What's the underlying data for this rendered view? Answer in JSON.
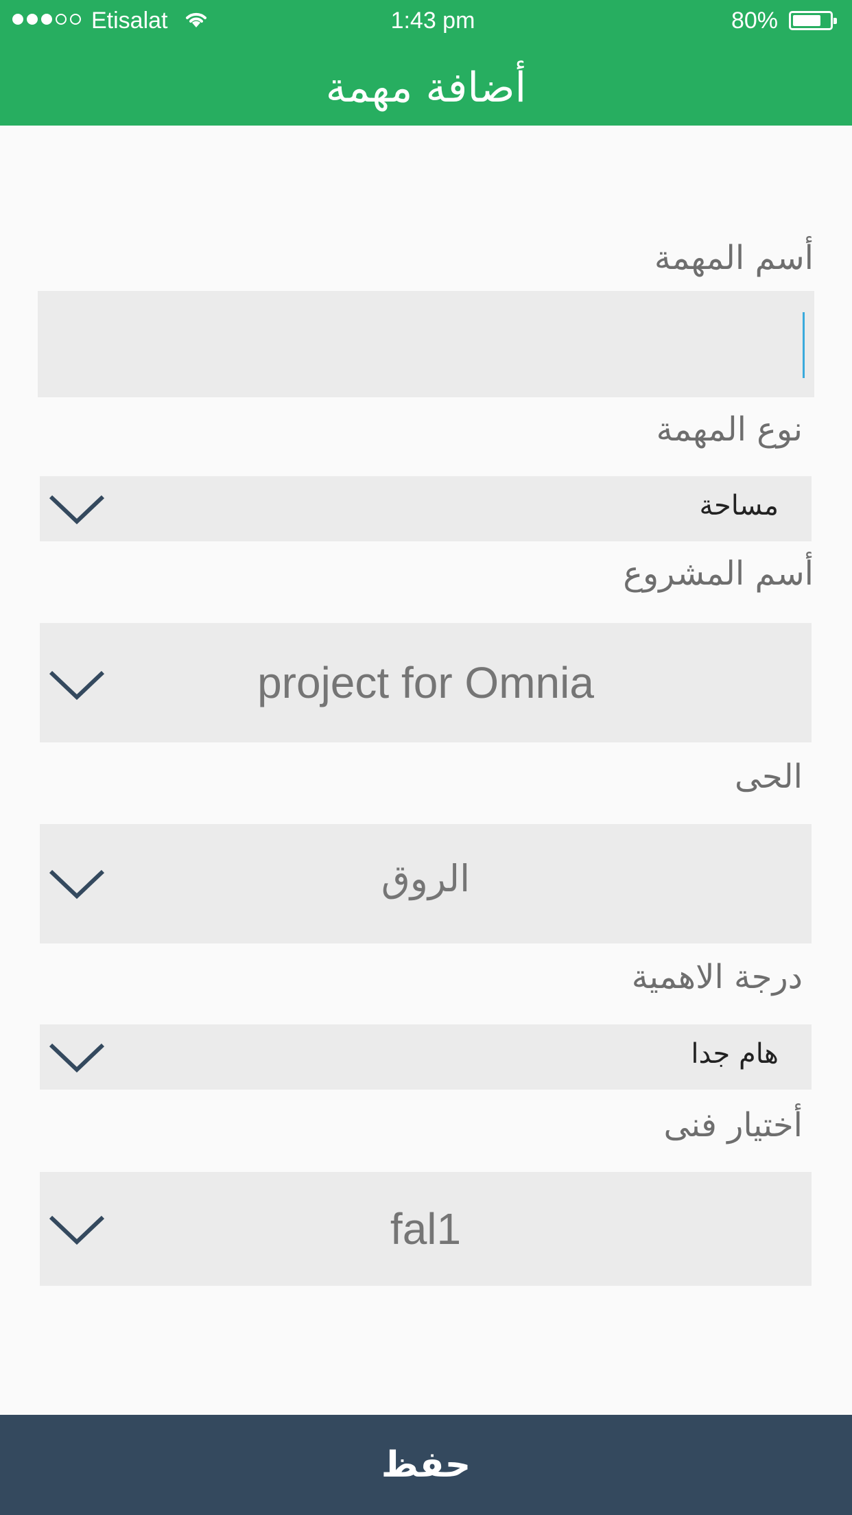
{
  "status_bar": {
    "carrier": "Etisalat",
    "time": "1:43 pm",
    "battery_percent": "80%",
    "battery_level": 0.8,
    "signal_bars": 3,
    "signal_total": 5
  },
  "header": {
    "title": "أضافة مهمة",
    "color": "#27ae60"
  },
  "form": {
    "task_name": {
      "label": "أسم المهمة",
      "value": ""
    },
    "task_type": {
      "label": "نوع المهمة",
      "value": "مساحة"
    },
    "project_name": {
      "label": "أسم المشروع",
      "value": "project for Omnia"
    },
    "district": {
      "label": "الحى",
      "value": "الروق"
    },
    "priority": {
      "label": "درجة الاهمية",
      "value": "هام جدا"
    },
    "technician": {
      "label": "أختيار فنى",
      "value": "fal1"
    }
  },
  "footer": {
    "save_label": "حفظ",
    "color": "#34495e"
  },
  "icons": {
    "dropdown": "chevron-down-icon",
    "wifi": "wifi-icon",
    "battery": "battery-icon"
  }
}
